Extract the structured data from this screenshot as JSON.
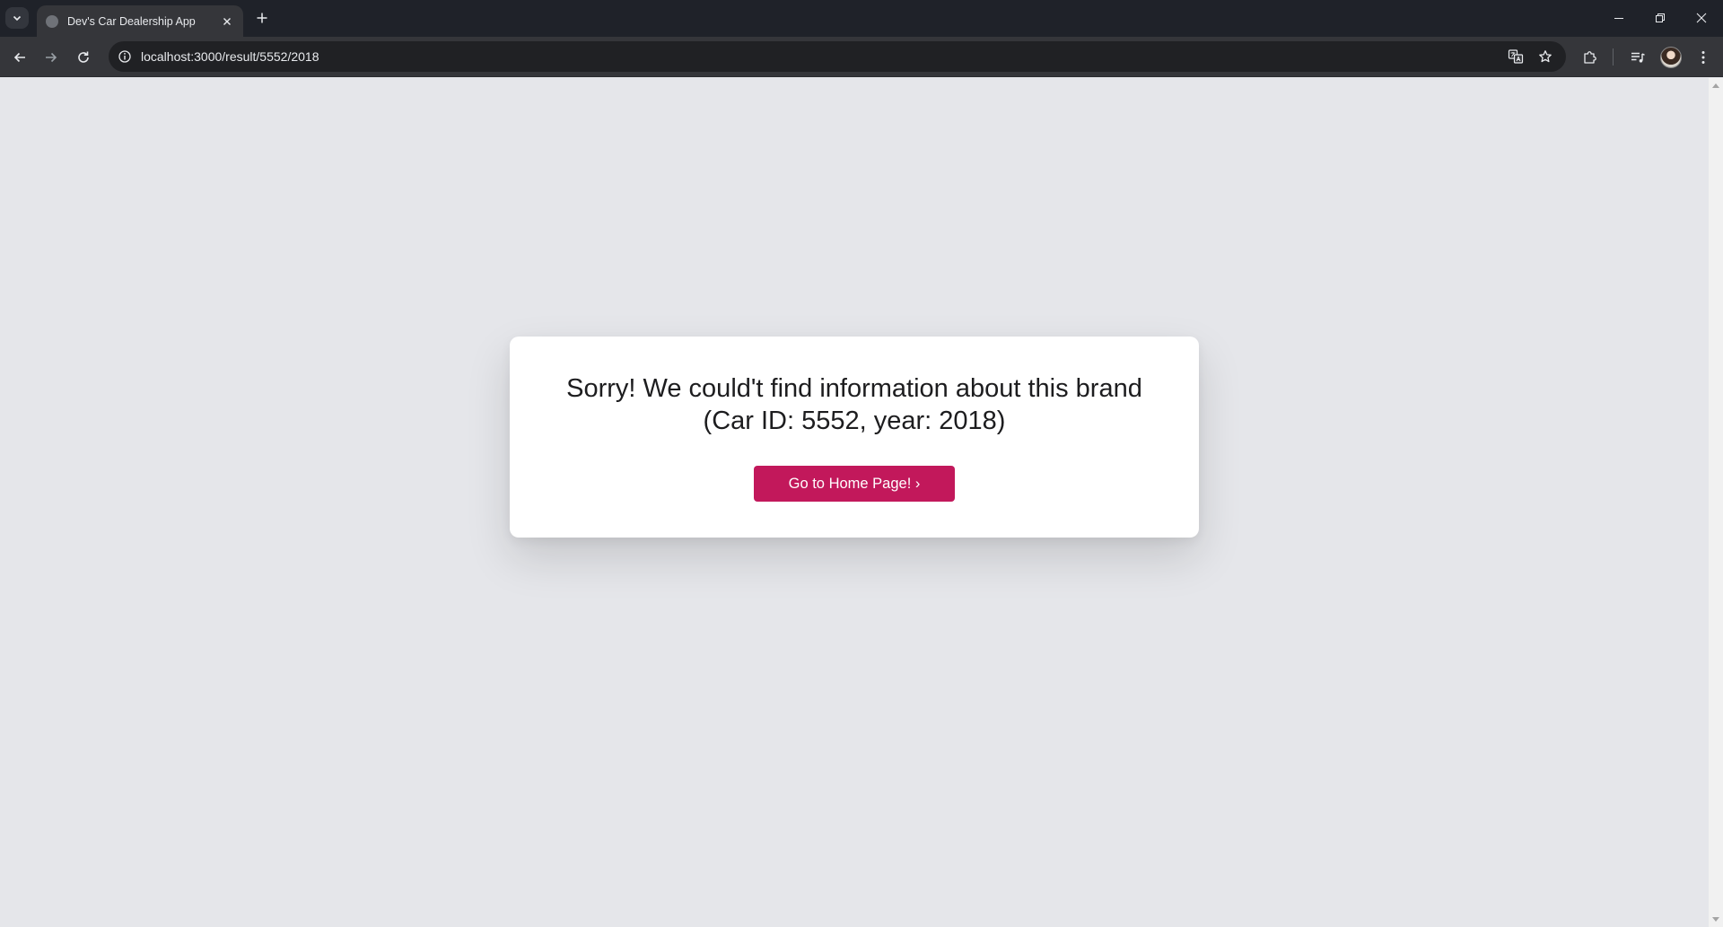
{
  "browser": {
    "tab": {
      "title": "Dev's Car Dealership App"
    },
    "address": {
      "url": "localhost:3000/result/5552/2018"
    },
    "icons": [
      "tab-search-icon",
      "globe-icon",
      "close-icon",
      "plus-icon",
      "minimize-icon",
      "restore-icon",
      "window-close-icon",
      "back-icon",
      "forward-icon",
      "reload-icon",
      "site-info-icon",
      "translate-icon",
      "star-icon",
      "extensions-icon",
      "media-icon",
      "avatar",
      "menu-icon"
    ]
  },
  "page": {
    "message_line1": "Sorry! We could't find information about this brand",
    "message_line2": "(Car ID: 5552, year: 2018)",
    "home_button_label": "Go to Home Page! ›"
  },
  "colors": {
    "page_background": "#e5e6ea",
    "card_background": "#ffffff",
    "button_background": "#c2185b",
    "button_text": "#ffffff",
    "chrome_dark": "#1f2229",
    "toolbar": "#35363a"
  }
}
